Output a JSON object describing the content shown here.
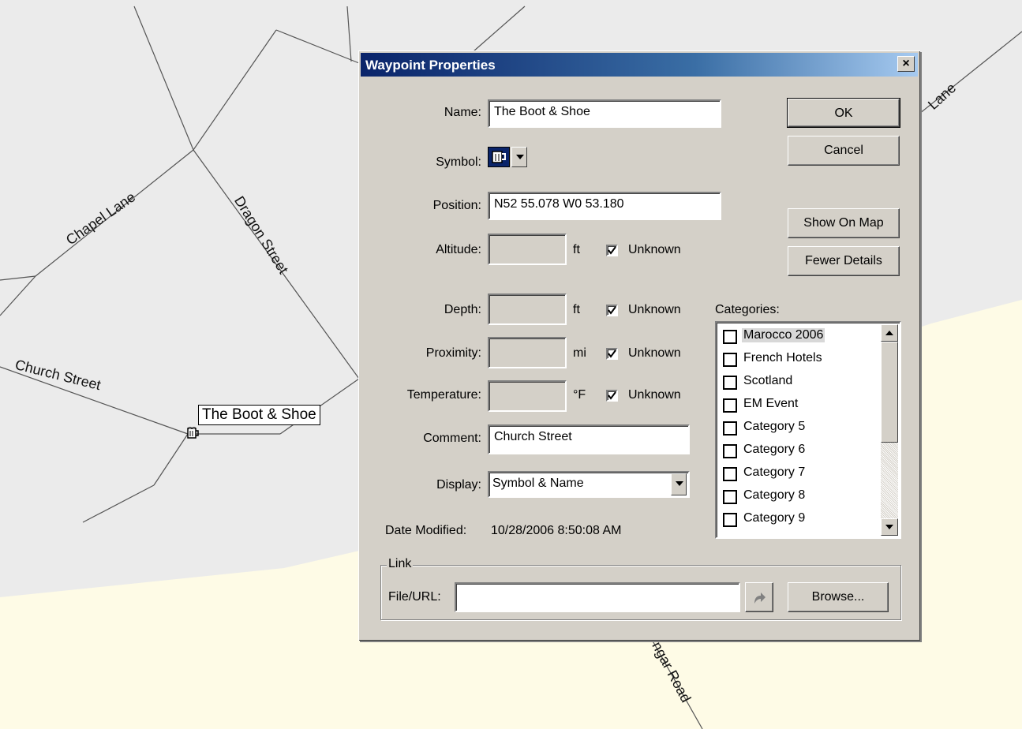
{
  "map": {
    "streets": [
      "Chapel Lane",
      "Dragon Street",
      "Church Street",
      "Lane",
      "ngar Road"
    ],
    "waypoint_label": "The Boot & Shoe",
    "waypoint_icon": "beer-mug-icon",
    "colors": {
      "land": "#ebebeb",
      "water": "#fefbe6",
      "road": "#555555"
    }
  },
  "dialog": {
    "title": "Waypoint Properties",
    "close_label": "×",
    "name_label": "Name:",
    "name_value": "The Boot & Shoe",
    "symbol_label": "Symbol:",
    "symbol_icon": "beer-mug-icon",
    "position_label": "Position:",
    "position_value": "N52 55.078 W0 53.180",
    "altitude_label": "Altitude:",
    "altitude_unit": "ft",
    "depth_label": "Depth:",
    "depth_unit": "ft",
    "proximity_label": "Proximity:",
    "proximity_unit": "mi",
    "temperature_label": "Temperature:",
    "temperature_unit": "°F",
    "unknown_label": "Unknown",
    "comment_label": "Comment:",
    "comment_value": "Church Street",
    "display_label": "Display:",
    "display_value": "Symbol & Name",
    "date_modified_label": "Date Modified:",
    "date_modified_value": "10/28/2006 8:50:08 AM",
    "buttons": {
      "ok": "OK",
      "cancel": "Cancel",
      "show_on_map": "Show On Map",
      "fewer_details": "Fewer Details",
      "browse": "Browse..."
    },
    "categories_label": "Categories:",
    "categories": [
      {
        "name": "Marocco 2006",
        "checked": false,
        "selected": true
      },
      {
        "name": "French Hotels",
        "checked": false
      },
      {
        "name": "Scotland",
        "checked": false
      },
      {
        "name": "EM Event",
        "checked": false
      },
      {
        "name": "Category 5",
        "checked": false
      },
      {
        "name": "Category 6",
        "checked": false
      },
      {
        "name": "Category 7",
        "checked": false
      },
      {
        "name": "Category 8",
        "checked": false
      },
      {
        "name": "Category 9",
        "checked": false
      }
    ],
    "link_group_label": "Link",
    "file_url_label": "File/URL:",
    "file_url_value": "",
    "colors": {
      "face": "#d4d0c8",
      "title_start": "#0a246a",
      "title_end": "#a6caf0"
    }
  }
}
